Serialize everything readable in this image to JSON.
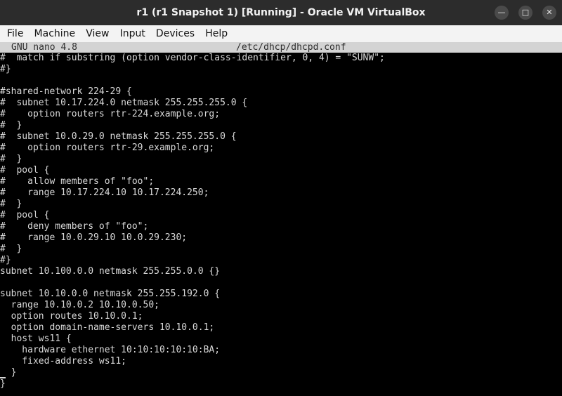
{
  "window": {
    "title": "r1 (r1 Snapshot 1) [Running] - Oracle VM VirtualBox",
    "buttons": {
      "minimize": "—",
      "maximize": "□",
      "close": "✕"
    }
  },
  "menu": [
    "File",
    "Machine",
    "View",
    "Input",
    "Devices",
    "Help"
  ],
  "nano": {
    "version": "GNU nano 4.8",
    "filename": "/etc/dhcp/dhcpd.conf"
  },
  "lines": [
    "#  match if substring (option vendor-class-identifier, 0, 4) = \"SUNW\";",
    "#}",
    "",
    "#shared-network 224-29 {",
    "#  subnet 10.17.224.0 netmask 255.255.255.0 {",
    "#    option routers rtr-224.example.org;",
    "#  }",
    "#  subnet 10.0.29.0 netmask 255.255.255.0 {",
    "#    option routers rtr-29.example.org;",
    "#  }",
    "#  pool {",
    "#    allow members of \"foo\";",
    "#    range 10.17.224.10 10.17.224.250;",
    "#  }",
    "#  pool {",
    "#    deny members of \"foo\";",
    "#    range 10.0.29.10 10.0.29.230;",
    "#  }",
    "#}",
    "subnet 10.100.0.0 netmask 255.255.0.0 {}",
    "",
    "subnet 10.10.0.0 netmask 255.255.192.0 {",
    "  range 10.10.0.2 10.10.0.50;",
    "  option routes 10.10.0.1;",
    "  option domain-name-servers 10.10.0.1;",
    "  host ws11 {",
    "    hardware ethernet 10:10:10:10:10:BA;",
    "    fixed-address ws11;",
    "  }",
    "}"
  ]
}
